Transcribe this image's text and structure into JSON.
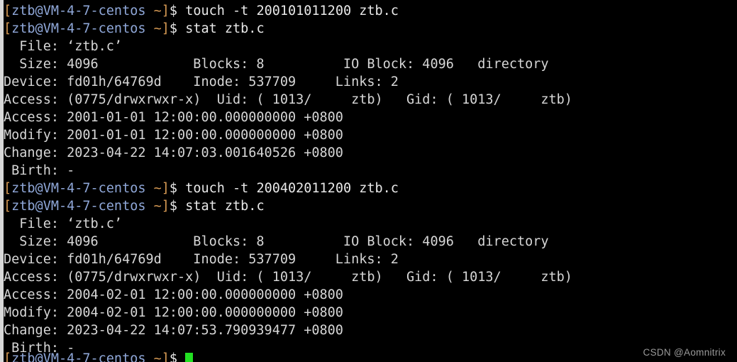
{
  "terminal": {
    "prompt": {
      "open_bracket": "[",
      "user_host": "ztb@VM-4-7-centos",
      "space_tilde_close": " ~]",
      "dollar": "$ "
    },
    "colors": {
      "background": "#000000",
      "foreground": "#d6d6d6",
      "prompt_bracket": "#d79a54",
      "prompt_user": "#8fa7d8",
      "cursor": "#22e022",
      "left_gutter": "#d8d8d8",
      "watermark": "#9a9a9a"
    },
    "lines": [
      {
        "type": "prompt",
        "command": "touch -t 200101011200 ztb.c"
      },
      {
        "type": "prompt",
        "command": "stat ztb.c"
      },
      {
        "type": "output",
        "text": "  File: ‘ztb.c’"
      },
      {
        "type": "output",
        "text": "  Size: 4096            Blocks: 8          IO Block: 4096   directory"
      },
      {
        "type": "output",
        "text": "Device: fd01h/64769d    Inode: 537709     Links: 2"
      },
      {
        "type": "output",
        "text": "Access: (0775/drwxrwxr-x)  Uid: ( 1013/     ztb)   Gid: ( 1013/     ztb)"
      },
      {
        "type": "output",
        "text": "Access: 2001-01-01 12:00:00.000000000 +0800"
      },
      {
        "type": "output",
        "text": "Modify: 2001-01-01 12:00:00.000000000 +0800"
      },
      {
        "type": "output",
        "text": "Change: 2023-04-22 14:07:03.001640526 +0800"
      },
      {
        "type": "output",
        "text": " Birth: -"
      },
      {
        "type": "prompt",
        "command": "touch -t 200402011200 ztb.c"
      },
      {
        "type": "prompt",
        "command": "stat ztb.c"
      },
      {
        "type": "output",
        "text": "  File: ‘ztb.c’"
      },
      {
        "type": "output",
        "text": "  Size: 4096            Blocks: 8          IO Block: 4096   directory"
      },
      {
        "type": "output",
        "text": "Device: fd01h/64769d    Inode: 537709     Links: 2"
      },
      {
        "type": "output",
        "text": "Access: (0775/drwxrwxr-x)  Uid: ( 1013/     ztb)   Gid: ( 1013/     ztb)"
      },
      {
        "type": "output",
        "text": "Access: 2004-02-01 12:00:00.000000000 +0800"
      },
      {
        "type": "output",
        "text": "Modify: 2004-02-01 12:00:00.000000000 +0800"
      },
      {
        "type": "output",
        "text": "Change: 2023-04-22 14:07:53.790939477 +0800"
      },
      {
        "type": "output",
        "text": " Birth: -"
      }
    ],
    "last_prompt": {
      "command": ""
    }
  },
  "watermark": {
    "text": "CSDN @Aomnitrix"
  }
}
